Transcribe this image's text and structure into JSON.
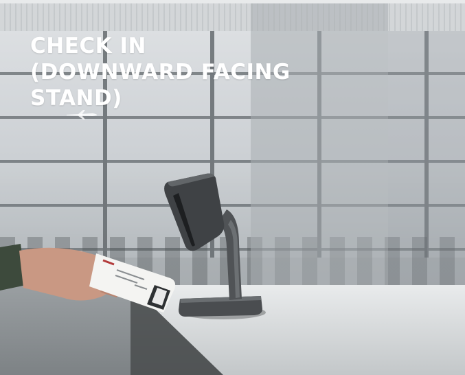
{
  "hero": {
    "title": "CHECK IN\n(DOWNWARD FACING\nSTAND)",
    "image_subject": "scanner-stand-with-boarding-pass",
    "colors": {
      "title": "#ffffff",
      "device": "#3f4245"
    }
  }
}
